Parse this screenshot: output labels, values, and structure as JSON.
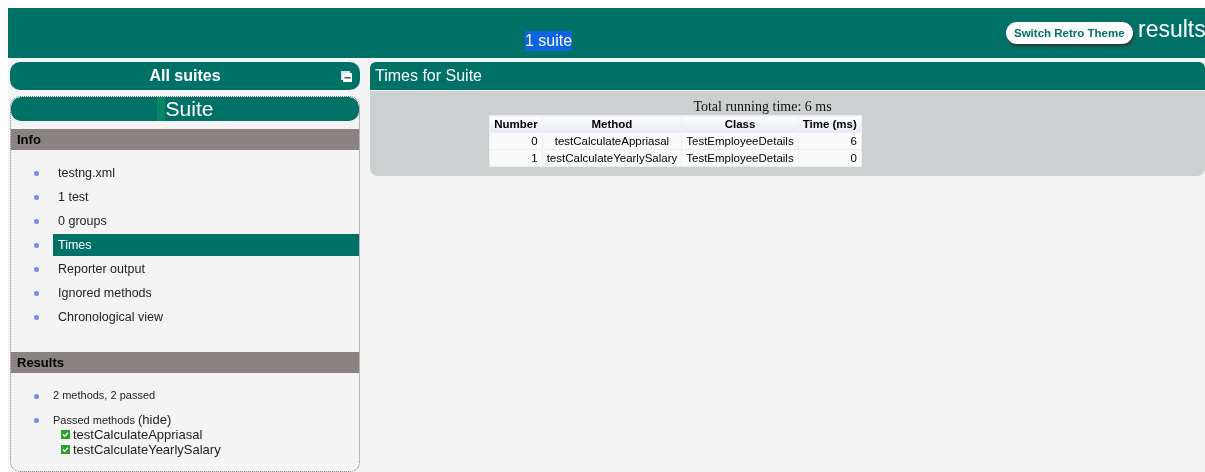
{
  "header": {
    "suite_count": "1 suite",
    "theme_button": "Switch Retro Theme",
    "title": "results"
  },
  "sidebar": {
    "title": "All suites",
    "suite_name": "Suite",
    "info": {
      "heading": "Info",
      "items": [
        {
          "label": "testng.xml",
          "selected": false
        },
        {
          "label": "1 test",
          "selected": false
        },
        {
          "label": "0 groups",
          "selected": false
        },
        {
          "label": "Times",
          "selected": true
        },
        {
          "label": "Reporter output",
          "selected": false
        },
        {
          "label": "Ignored methods",
          "selected": false
        },
        {
          "label": "Chronological view",
          "selected": false
        }
      ]
    },
    "results": {
      "heading": "Results",
      "summary": "2 methods, 2 passed",
      "passed_label": "Passed methods",
      "hide_link": "(hide)",
      "methods": [
        {
          "name": "testCalculateAppriasal",
          "passed": true
        },
        {
          "name": "testCalculateYearlySalary",
          "passed": true
        }
      ]
    }
  },
  "main": {
    "title": "Times for Suite",
    "total": "Total running time: 6 ms",
    "table": {
      "columns": [
        "Number",
        "Method",
        "Class",
        "Time (ms)"
      ],
      "rows": [
        [
          "0",
          "testCalculateAppriasal",
          "TestEmployeeDetails",
          "6"
        ],
        [
          "1",
          "testCalculateYearlySalary",
          "TestEmployeeDetails",
          "0"
        ]
      ]
    }
  }
}
